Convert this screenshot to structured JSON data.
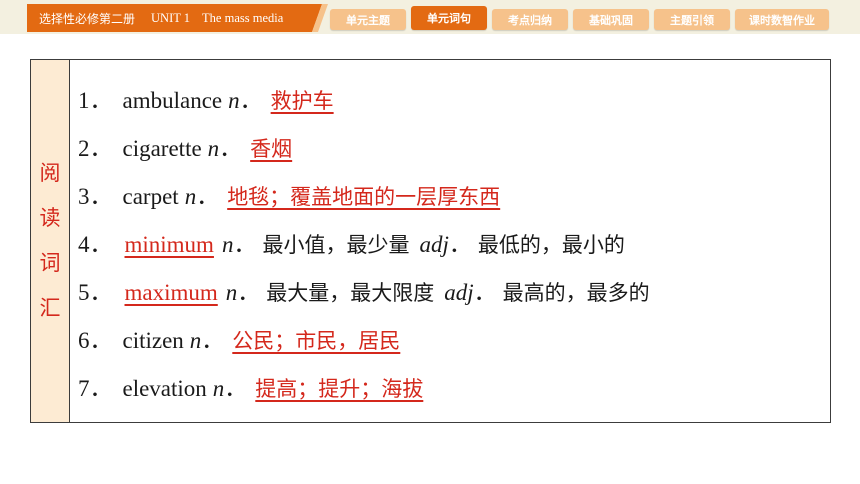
{
  "header": {
    "book": "选择性必修第二册",
    "unit": "UNIT 1",
    "topic": "The mass media",
    "tabs": [
      {
        "label": "单元主题",
        "active": false
      },
      {
        "label": "单元词句",
        "active": true
      },
      {
        "label": "考点归纳",
        "active": false
      },
      {
        "label": "基础巩固",
        "active": false
      },
      {
        "label": "主题引领",
        "active": false
      },
      {
        "label": "课时数智作业",
        "active": false
      }
    ]
  },
  "side_label": [
    "阅",
    "读",
    "词",
    "汇"
  ],
  "rows": [
    {
      "num": "1．",
      "word": "ambulance",
      "pos": "n",
      "answer": "救护车"
    },
    {
      "num": "2．",
      "word": "cigarette",
      "pos": "n",
      "answer": "香烟"
    },
    {
      "num": "3．",
      "word": "carpet",
      "pos": "n",
      "answer": "地毯；覆盖地面的一层厚东西"
    },
    {
      "num": "4．",
      "answer_word": "minimum",
      "pos": "n",
      "meaning1": "最小值，最少量",
      "pos2": "adj",
      "meaning2": "最低的，最小的"
    },
    {
      "num": "5．",
      "answer_word": "maximum",
      "pos": "n",
      "meaning1": "最大量，最大限度",
      "pos2": "adj",
      "meaning2": "最高的，最多的"
    },
    {
      "num": "6．",
      "word": "citizen",
      "pos": "n",
      "answer": "公民；市民，居民"
    },
    {
      "num": "7．",
      "word": "elevation",
      "pos": "n",
      "answer": "提高；提升；海拔"
    }
  ],
  "colors": {
    "accent": "#e36a12",
    "tab": "#f6c28b",
    "answer": "#d4281c",
    "side_bg": "#fdebd3"
  }
}
